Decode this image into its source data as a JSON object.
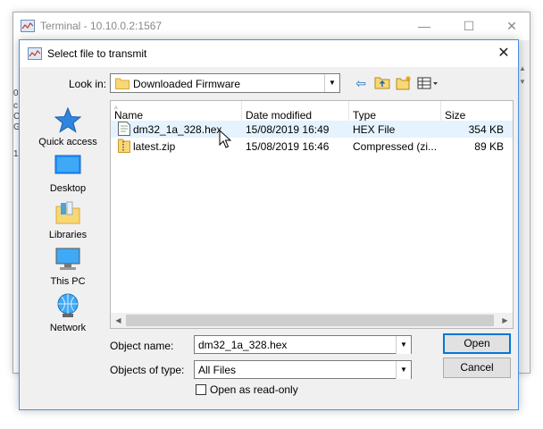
{
  "background_window": {
    "title": "Terminal - 10.10.0.2:1567",
    "minimize": "—",
    "maximize": "☐",
    "close": "✕",
    "left_fragments": [
      "0",
      "c",
      "C",
      "G",
      "1"
    ]
  },
  "dialog": {
    "title": "Select file to transmit",
    "close": "✕"
  },
  "look_in": {
    "label": "Look in:",
    "value": "Downloaded Firmware"
  },
  "places": [
    {
      "label": "Quick access",
      "icon": "star-icon"
    },
    {
      "label": "Desktop",
      "icon": "desktop-icon"
    },
    {
      "label": "Libraries",
      "icon": "libraries-icon"
    },
    {
      "label": "This PC",
      "icon": "computer-icon"
    },
    {
      "label": "Network",
      "icon": "network-icon"
    }
  ],
  "file_list": {
    "columns": [
      "Name",
      "Date modified",
      "Type",
      "Size"
    ],
    "rows": [
      {
        "name": "dm32_1a_328.hex",
        "date": "15/08/2019 16:49",
        "type": "HEX File",
        "size": "354 KB"
      },
      {
        "name": "latest.zip",
        "date": "15/08/2019 16:46",
        "type": "Compressed (zi...",
        "size": "89 KB"
      }
    ]
  },
  "form": {
    "object_name_label": "Object name:",
    "object_name_value": "dm32_1a_328.hex",
    "objects_type_label": "Objects of type:",
    "objects_type_value": "All Files",
    "read_only_label": "Open as read-only",
    "open_label": "Open",
    "cancel_label": "Cancel"
  },
  "colors": {
    "accent": "#0078d7",
    "hover_row": "#e5f3ff",
    "folder": "#f8d775"
  }
}
